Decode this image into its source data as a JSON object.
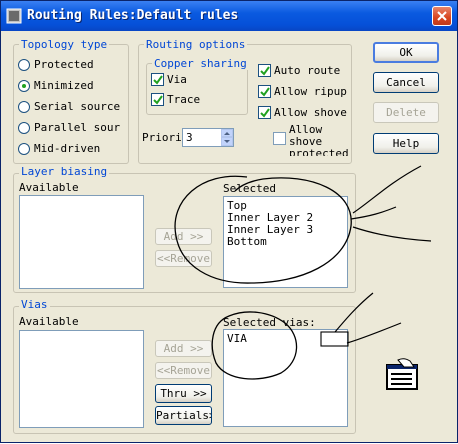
{
  "window": {
    "title": "Routing Rules:Default rules"
  },
  "topology": {
    "title": "Topology type",
    "options": [
      {
        "label": "Protected",
        "checked": false
      },
      {
        "label": "Minimized",
        "checked": true
      },
      {
        "label": "Serial source",
        "checked": false
      },
      {
        "label": "Parallel sour",
        "checked": false
      },
      {
        "label": "Mid-driven",
        "checked": false
      }
    ]
  },
  "routing_options": {
    "title": "Routing options",
    "copper_sharing": {
      "title": "Copper sharing",
      "via_label": "Via",
      "via_checked": true,
      "trace_label": "Trace",
      "trace_checked": true
    },
    "auto_route": "Auto route",
    "allow_ripup": "Allow ripup",
    "allow_shove": "Allow shove",
    "allow_shove_protected_line1": "Allow",
    "allow_shove_protected_line2": "shove",
    "allow_shove_protected_line3": "protected",
    "priority_label": "Priori",
    "priority_value": "3"
  },
  "buttons": {
    "ok": "OK",
    "cancel": "Cancel",
    "delete": "Delete",
    "help": "Help"
  },
  "layer_biasing": {
    "title": "Layer biasing",
    "available_label": "Available",
    "selected_label": "Selected",
    "add": "Add >>",
    "remove": "<<Remove",
    "selected_items": [
      "Top",
      "Inner Layer 2",
      "Inner Layer 3",
      "Bottom"
    ]
  },
  "vias": {
    "title": "Vias",
    "available_label": "Available",
    "selected_label": "Selected vias:",
    "add": "Add >>",
    "remove": "<<Remove",
    "thru": "Thru >>",
    "partials": "Partials>>",
    "selected_items": [
      "VIA"
    ]
  },
  "colors": {
    "title_bar": "#0a5ae0",
    "dialog_bg": "#ece9d8",
    "group_title": "#0046d5",
    "check_mark": "#21a121"
  }
}
